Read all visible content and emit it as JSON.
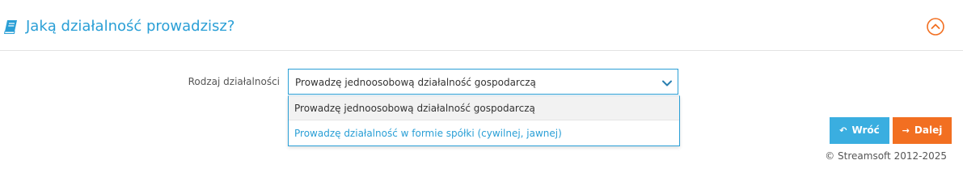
{
  "header": {
    "title": "Jaką działalność prowadzisz?",
    "icon": "book-icon",
    "collapse_icon": "chevron-up-circle-icon"
  },
  "form": {
    "label": "Rodzaj działalności",
    "selected_value": "Prowadzę jednoosobową działalność gospodarczą",
    "options": [
      "Prowadzę jednoosobową działalność gospodarczą",
      "Prowadzę działalność w formie spółki (cywilnej, jawnej)"
    ]
  },
  "buttons": {
    "back_label": "Wróć",
    "back_icon": "reply-arrow-icon",
    "next_label": "Dalej",
    "next_icon": "arrow-right-icon"
  },
  "footer": {
    "copyright": "© Streamsoft 2012-2025"
  },
  "colors": {
    "accent": "#2a9fd6",
    "back_button": "#3aaee0",
    "next_button": "#f26f21",
    "collapse_icon": "#f26f21"
  }
}
